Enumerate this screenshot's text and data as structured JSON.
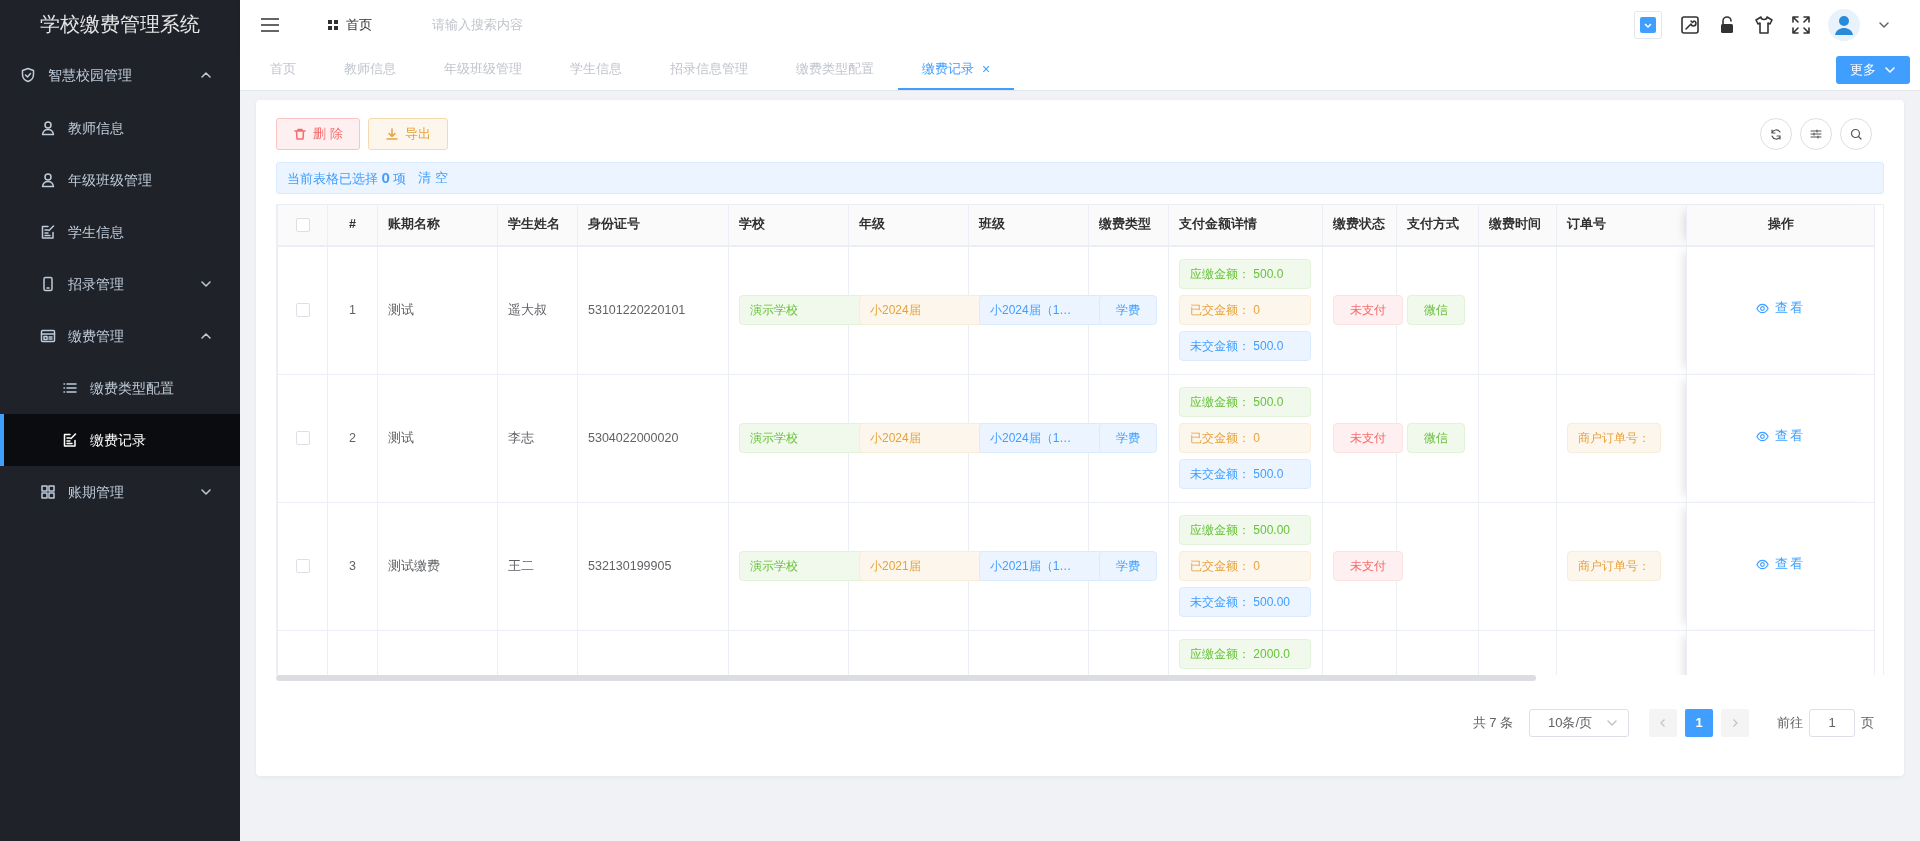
{
  "sidebar": {
    "title": "学校缴费管理系统",
    "items": [
      {
        "label": "智慧校园管理",
        "expanded": true,
        "selected": false,
        "children": [
          {
            "label": "教师信息",
            "selected": false
          },
          {
            "label": "年级班级管理",
            "selected": false
          },
          {
            "label": "学生信息",
            "selected": false
          },
          {
            "label": "招录管理",
            "expanded": false,
            "selected": false
          },
          {
            "label": "缴费管理",
            "expanded": true,
            "selected": false,
            "children": [
              {
                "label": "缴费类型配置",
                "selected": false
              },
              {
                "label": "缴费记录",
                "selected": true
              }
            ]
          },
          {
            "label": "账期管理",
            "expanded": false,
            "selected": false
          }
        ]
      }
    ]
  },
  "topbar": {
    "breadcrumb": "首页",
    "search": {
      "placeholder": "请输入搜索内容"
    }
  },
  "tabs": [
    {
      "label": "首页",
      "selected": false
    },
    {
      "label": "教师信息",
      "selected": false
    },
    {
      "label": "年级班级管理",
      "selected": false
    },
    {
      "label": "学生信息",
      "selected": false
    },
    {
      "label": "招录信息管理",
      "selected": false
    },
    {
      "label": "缴费类型配置",
      "selected": false
    },
    {
      "label": "缴费记录",
      "selected": true,
      "close": "×"
    }
  ],
  "more_button": "更多",
  "toolbar": {
    "buttons": [
      {
        "kind": "delete",
        "label": "删 除"
      },
      {
        "kind": "export",
        "label": "导出"
      }
    ]
  },
  "selection_bar": {
    "text": "当前表格已选择 **0** 项",
    "clear": "清 空"
  },
  "table": {
    "select_all_checked": false,
    "columns": [
      "#",
      "账期名称",
      "学生姓名",
      "身份证号",
      "学校",
      "年级",
      "班级",
      "缴费类型",
      "支付金额详情",
      "缴费状态",
      "支付方式",
      "缴费时间",
      "订单号",
      "操作"
    ],
    "rows": [
      {
        "checked": false,
        "index": "1",
        "bill": "测试",
        "name": "遥大叔",
        "id_number": "53101220220101",
        "school": "演示学校",
        "grade": "小2024届",
        "class": "小2024届（1…",
        "fee_type": "学费",
        "amounts": [
          {
            "kind": "due",
            "label": "应缴金额：",
            "value": "500.0"
          },
          {
            "kind": "paid",
            "label": "已交金额：",
            "value": "0"
          },
          {
            "kind": "unpaid",
            "label": "未交金额：",
            "value": "500.0"
          }
        ],
        "status": "未支付",
        "pay_method": "微信",
        "action": "查看"
      },
      {
        "checked": false,
        "index": "2",
        "bill": "测试",
        "name": "李志",
        "id_number": "5304022000020",
        "school": "演示学校",
        "grade": "小2024届",
        "class": "小2024届（1…",
        "fee_type": "学费",
        "amounts": [
          {
            "kind": "due",
            "label": "应缴金额：",
            "value": "500.0"
          },
          {
            "kind": "paid",
            "label": "已交金额：",
            "value": "0"
          },
          {
            "kind": "unpaid",
            "label": "未交金额：",
            "value": "500.0"
          }
        ],
        "status": "未支付",
        "pay_method": "微信",
        "order": "商户订单号：",
        "action": "查看"
      },
      {
        "checked": false,
        "index": "3",
        "bill": "测试缴费",
        "name": "王二",
        "id_number": "532130199905",
        "school": "演示学校",
        "grade": "小2021届",
        "class": "小2021届（1…",
        "fee_type": "学费",
        "amounts": [
          {
            "kind": "due",
            "label": "应缴金额：",
            "value": "500.00"
          },
          {
            "kind": "paid",
            "label": "已交金额：",
            "value": "0"
          },
          {
            "kind": "unpaid",
            "label": "未交金额：",
            "value": "500.00"
          }
        ],
        "status": "未支付",
        "order": "商户订单号：",
        "action": "查看"
      },
      {
        "amounts": [
          {
            "kind": "due",
            "label": "应缴金额：",
            "value": "2000.0"
          }
        ]
      }
    ]
  },
  "pagination": {
    "total": "共 7 条",
    "page_size": "10条/页",
    "pages": [
      {
        "label": "1",
        "selected": true
      }
    ],
    "goto_label": "前往",
    "goto_value": "1",
    "page_suffix": "页"
  }
}
